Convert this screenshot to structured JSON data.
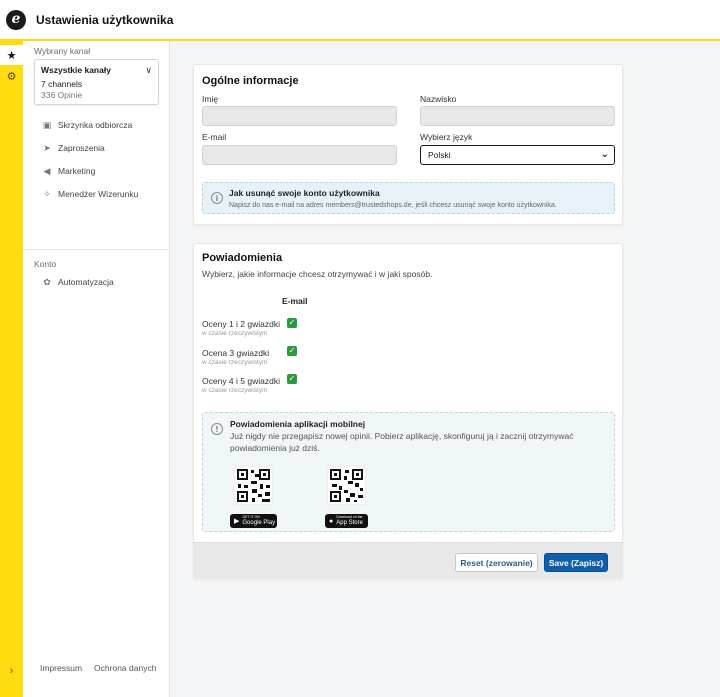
{
  "app": {
    "title": "Ustawienia użytkownika",
    "logo_letter": "e"
  },
  "rail": {
    "icons": [
      "star-icon",
      "gear-icon",
      "chevron-right-icon"
    ]
  },
  "sidebar": {
    "channel_label": "Wybrany kanał",
    "channel": {
      "name": "Wszystkie kanały",
      "count": "7 channels",
      "reviews": "336 Opinie"
    },
    "items": [
      {
        "label": "Skrzynka odbiorcza",
        "icon": "inbox-icon"
      },
      {
        "label": "Zaproszenia",
        "icon": "paper-plane-icon"
      },
      {
        "label": "Marketing",
        "icon": "megaphone-icon"
      },
      {
        "label": "Menedżer Wizerunku",
        "icon": "sparkle-icon"
      }
    ],
    "account_label": "Konto",
    "account_items": [
      {
        "label": "Automatyzacja",
        "icon": "gears-icon"
      }
    ],
    "footer": {
      "impressum": "Impressum",
      "privacy": "Ochrona danych"
    }
  },
  "general": {
    "title": "Ogólne informacje",
    "first_name_label": "Imię",
    "first_name_value": "",
    "last_name_label": "Nazwisko",
    "last_name_value": "",
    "email_label": "E-mail",
    "email_value": "",
    "language_label": "Wybierz język",
    "language_value": "Polski",
    "delete_info": {
      "title": "Jak usunąć swoje konto użytkownika",
      "text": "Napisz do nas e-mail na adres members@trustedshops.de, jeśli chcesz usunąć swoje konto użytkownika."
    }
  },
  "notifications": {
    "title": "Powiadomienia",
    "subtitle": "Wybierz, jakie informacje chcesz otrzymywać i w jaki sposób.",
    "column": "E-mail",
    "rows": [
      {
        "label": "Oceny 1 i 2 gwiazdki",
        "sub": "w czasie rzeczywistym",
        "checked": true
      },
      {
        "label": "Ocena 3 gwiazdki",
        "sub": "w czasie rzeczywistym",
        "checked": true
      },
      {
        "label": "Oceny 4 i 5 gwiazdki",
        "sub": "w czasie rzeczywistym",
        "checked": true
      }
    ],
    "mobile": {
      "title": "Powiadomienia aplikacji mobilnej",
      "text_line1": "Już nigdy nie przegapisz nowej opinii. Pobierz aplikację, skonfiguruj ją i zacznij otrzymywać",
      "text_line2": "powiadomienia już dziś.",
      "google_small": "GET IT ON",
      "google_big": "Google Play",
      "apple_small": "Download on the",
      "apple_big": "App Store"
    }
  },
  "actions": {
    "reset": "Reset (zerowanie)",
    "save": "Save (Zapisz)"
  },
  "colors": {
    "accent_yellow": "#ffdc0f",
    "primary_blue": "#0d5fab",
    "check_green": "#2e9a3e",
    "info_bg": "#e6f2f8"
  }
}
